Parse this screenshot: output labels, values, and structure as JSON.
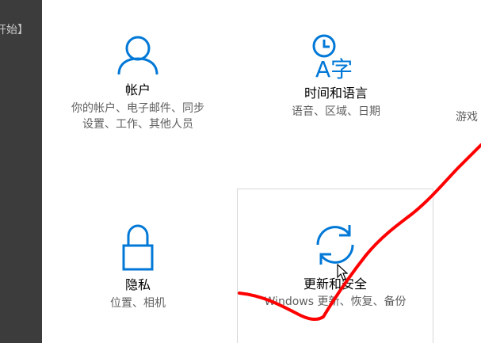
{
  "background_text": "开始】",
  "accent_color": "#0078d7",
  "tiles": {
    "account": {
      "icon": "person-icon",
      "name": "帐户",
      "desc": "你的帐户、电子邮件、同步\n设置、工作、其他人员"
    },
    "time_language": {
      "icon": "time-language-icon",
      "icon_text": "A字",
      "name": "时间和语言",
      "desc": "语音、区域、日期"
    },
    "gaming": {
      "desc": "游戏"
    },
    "privacy": {
      "icon": "lock-icon",
      "name": "隐私",
      "desc": "位置、相机"
    },
    "update_security": {
      "icon": "sync-icon",
      "name": "更新和安全",
      "desc": "Windows 更新、恢复、备份"
    }
  },
  "annotation": {
    "color": "#ff0000",
    "shape": "hand-drawn-red-line"
  }
}
